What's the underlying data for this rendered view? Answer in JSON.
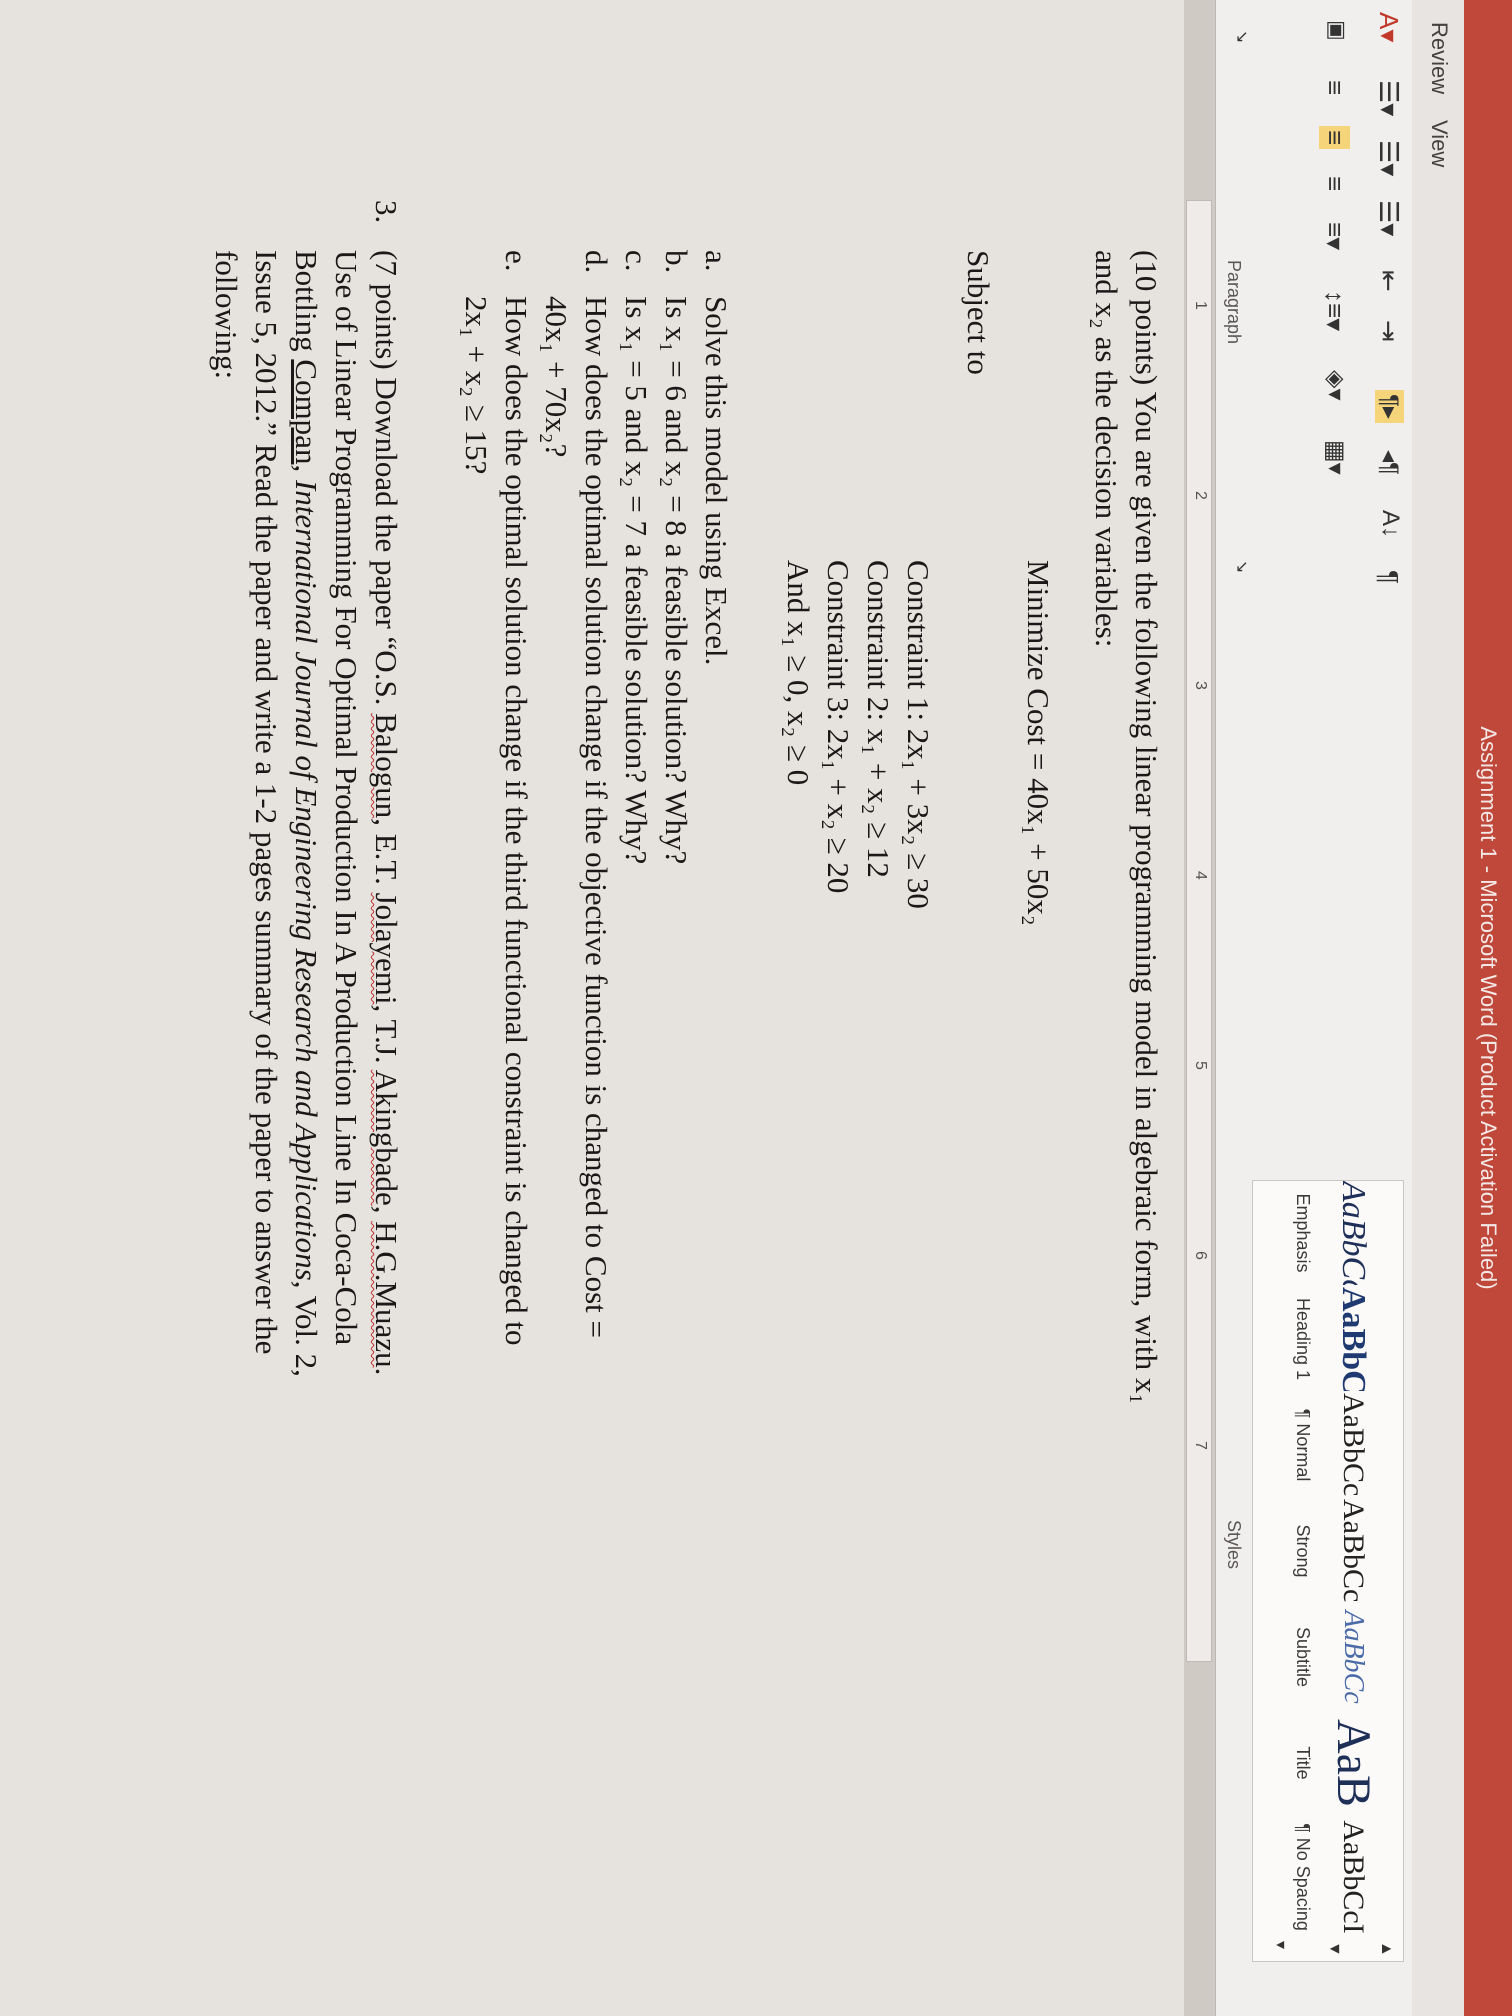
{
  "window": {
    "title": "Assignment 1 - Microsoft Word (Product Activation Failed)"
  },
  "tabs": [
    "Review",
    "View"
  ],
  "ribbon": {
    "paragraph_group_label": "Paragraph",
    "styles_group_label": "Styles",
    "styles": [
      {
        "preview": "AaBbCcL",
        "label": "Emphasis"
      },
      {
        "preview": "AaBbCc",
        "label": "Heading 1"
      },
      {
        "preview": "AaBbCcI",
        "label": "¶ Normal"
      },
      {
        "preview": "AaBbCcl",
        "label": "Strong"
      },
      {
        "preview": "AaBbCc",
        "label": "Subtitle"
      },
      {
        "preview": "AaB",
        "label": "Title"
      },
      {
        "preview": "AaBbCcI",
        "label": "¶ No Spacing"
      }
    ]
  },
  "ruler": {
    "ticks": [
      "1",
      "2",
      "3",
      "4",
      "5",
      "6",
      "7"
    ]
  },
  "document": {
    "q2_line1": "(10 points) You are given the following linear programming model in algebraic form, with x₁",
    "q2_line2": "and x₂ as the decision variables:",
    "objective": "Minimize Cost = 40x₁ + 50x₂",
    "subject_to": "Subject to",
    "constraint1": "Constraint 1: 2x₁ + 3x₂ ≥ 30",
    "constraint2": "Constraint 2: x₁ + x₂ ≥ 12",
    "constraint3": "Constraint 3: 2x₁ + x₂ ≥ 20",
    "nonneg": "And x₁ ≥ 0, x₂ ≥ 0",
    "parts": [
      {
        "marker": "a.",
        "text": "Solve this model using Excel."
      },
      {
        "marker": "b.",
        "text": "Is x₁ = 6 and x₂ = 8 a feasible solution? Why?"
      },
      {
        "marker": "c.",
        "text": "Is x₁ = 5 and x₂ = 7 a feasible solution? Why?"
      },
      {
        "marker": "d.",
        "text": "How does the optimal solution change if the objective function is changed to Cost =",
        "cont": "40x₁ + 70x₂?"
      },
      {
        "marker": "e.",
        "text": "How does the optimal solution change if the third functional constraint is changed to",
        "cont": "2x₁ + x₂ ≥ 15?"
      }
    ],
    "q3": {
      "number": "3.",
      "l1a": "(7 points) Download the paper “O.S. ",
      "l1_balogun": "Balogun",
      "l1b": ", E.T. ",
      "l1_jolayemi": "Jolayemi",
      "l1c": ", T.J. ",
      "l1_akingbade": "Akingbade",
      "l1d": ", ",
      "l1_muazu": "H.G.Muazu",
      "l1e": ".",
      "l2": "Use of Linear Programming For Optimal Production In A Production Line In Coca-Cola",
      "l3a": "Bottling ",
      "l3_compan": "Compan",
      "l3b": ", ",
      "l3_journal": "International Journal of Engineering Research and Applications",
      "l3c": ", Vol. 2,",
      "l4": "Issue 5, 2012.” Read the paper and write a 1-2 pages summary of the paper to answer the",
      "l5": "following:"
    }
  }
}
